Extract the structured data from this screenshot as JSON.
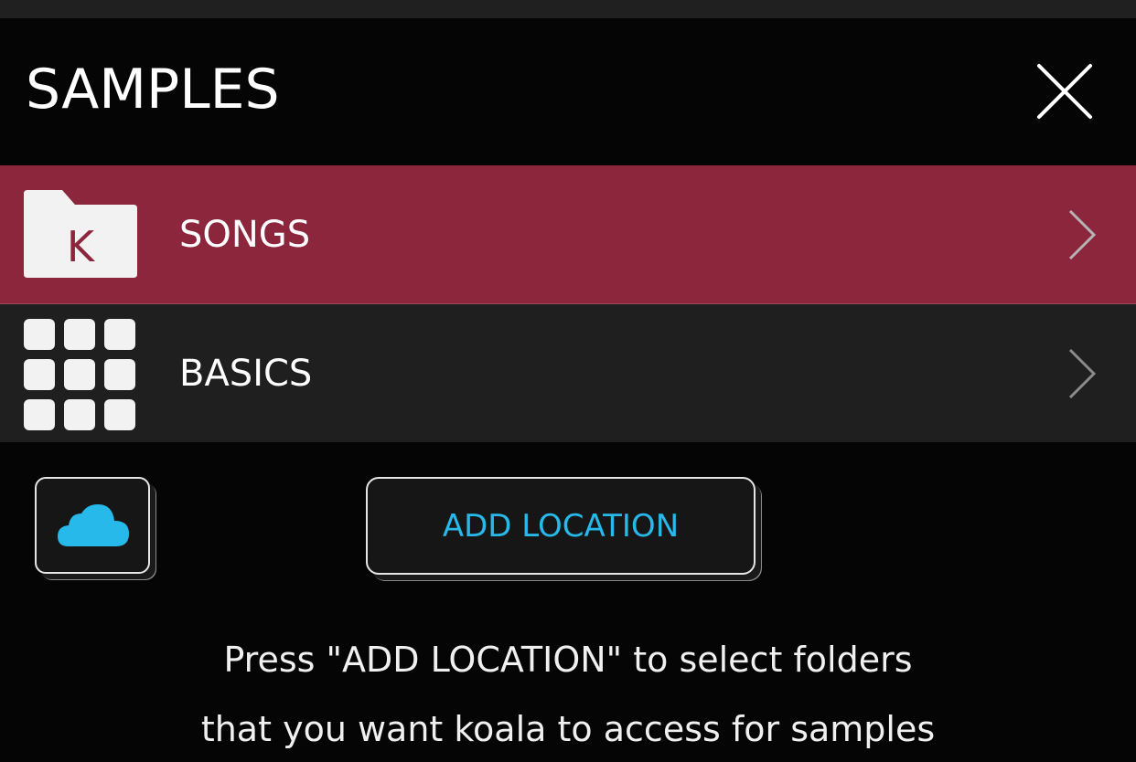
{
  "header": {
    "title": "SAMPLES",
    "close_icon": "close-icon"
  },
  "locations": [
    {
      "label": "SONGS",
      "icon": "koala-folder-icon",
      "icon_letter": "K",
      "selected": true
    },
    {
      "label": "BASICS",
      "icon": "pad-grid-icon",
      "selected": false
    }
  ],
  "actions": {
    "cloud_icon": "cloud-icon",
    "add_location_label": "ADD LOCATION"
  },
  "hint": {
    "line1": "Press \"ADD LOCATION\" to select folders",
    "line2": "that you want koala to access for samples"
  },
  "colors": {
    "selected_row": "#8b263d",
    "row": "#1f1f1f",
    "accent": "#27b9ea",
    "background": "#050505"
  }
}
